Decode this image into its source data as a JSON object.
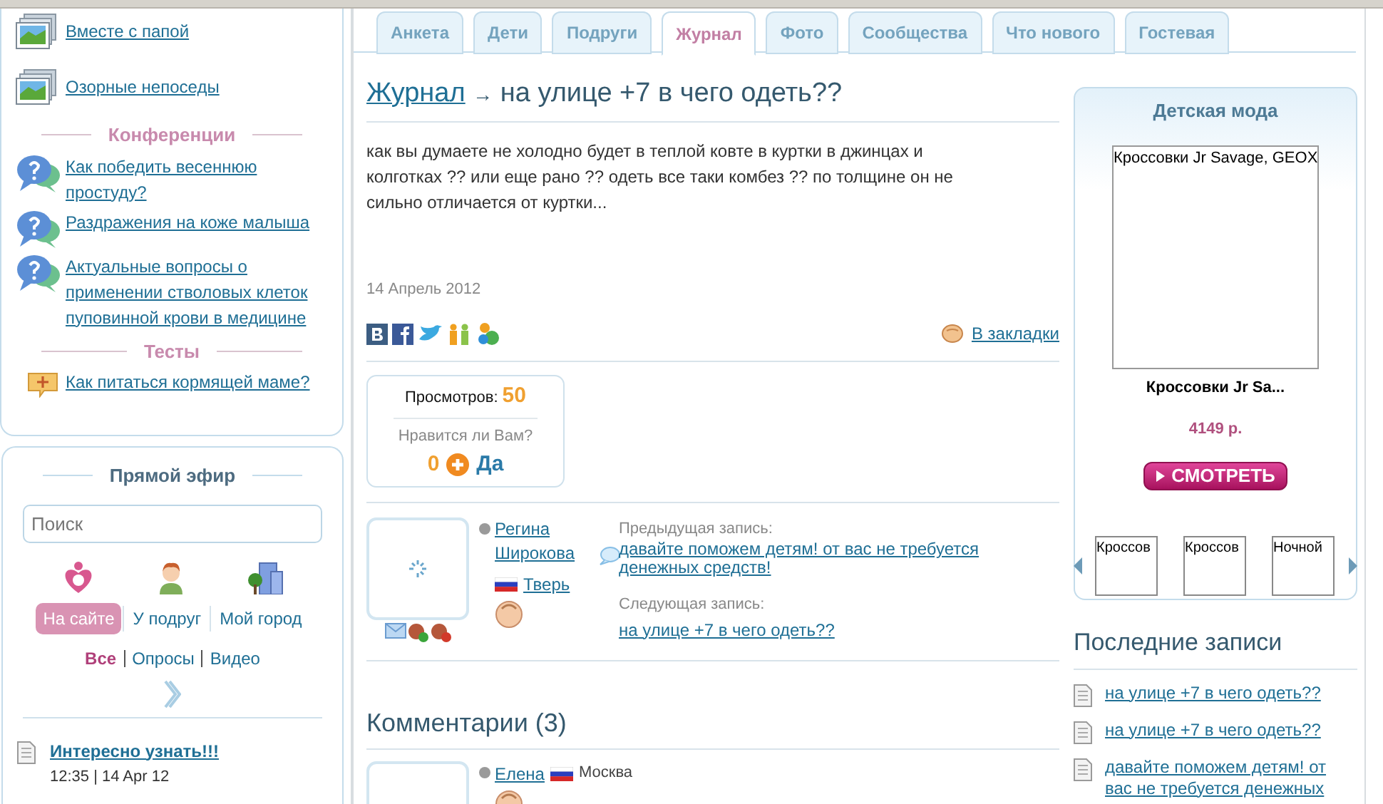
{
  "albums": [
    {
      "text": "Вместе с папой"
    },
    {
      "text": "Озорные непоседы"
    }
  ],
  "conferences": {
    "title": "Конференции",
    "items": [
      "Как победить весеннюю простуду?",
      "Раздражения на коже малыша",
      "Актуальные вопросы о применении стволовых клеток пуповинной крови в медицине"
    ]
  },
  "tests": {
    "title": "Тесты",
    "items": [
      "Как питаться кормящей маме?"
    ]
  },
  "live": {
    "title": "Прямой эфир",
    "search": {
      "placeholder": "Поиск"
    },
    "scopes": [
      {
        "label": "На сайте",
        "selected": true
      },
      {
        "label": "У подруг",
        "selected": false
      },
      {
        "label": "Мой город",
        "selected": false
      }
    ],
    "filters": [
      {
        "label": "Все",
        "selected": true
      },
      {
        "label": "Опросы",
        "selected": false
      },
      {
        "label": "Видео",
        "selected": false
      }
    ],
    "feed": [
      {
        "title": "Интересно узнать!!!",
        "meta": "12:35 | 14 Apr 12"
      }
    ]
  },
  "tabs": [
    {
      "label": "Анкета",
      "selected": false
    },
    {
      "label": "Дети",
      "selected": false
    },
    {
      "label": "Подруги",
      "selected": false
    },
    {
      "label": "Журнал",
      "selected": true
    },
    {
      "label": "Фото",
      "selected": false
    },
    {
      "label": "Сообщества",
      "selected": false
    },
    {
      "label": "Что нового",
      "selected": false
    },
    {
      "label": "Гостевая",
      "selected": false
    }
  ],
  "post": {
    "section": "Журнал",
    "arrow": "→",
    "title": "на улице +7 в чего одеть??",
    "body": "как вы думаете не холодно будет в теплой ковте в куртки в джинцах и колготках ?? или еще рано ?? одеть все таки комбез ?? по толщине он не сильно отличается от куртки...",
    "date": "14 Апрель 2012",
    "bookmark": "В закладки"
  },
  "stats": {
    "views_label": "Просмотров:",
    "views": "50",
    "question": "Нравится ли Вам?",
    "likes": "0",
    "like_button": "Да"
  },
  "author": {
    "name": "Регина Широкова",
    "online": false,
    "city": "Тверь",
    "prev_label": "Предыдущая запись:",
    "prev": "давайте поможем детям! от вас не требуется денежных средств!",
    "next_label": "Следующая запись:",
    "next": "на улице +7 в чего одеть??"
  },
  "comments": {
    "title": "Комментарии (3)",
    "items": [
      {
        "name": "Елена",
        "online": false,
        "city": "Москва"
      }
    ]
  },
  "ad": {
    "title": "Детская мода",
    "image_caption": "Кроссовки Jr Savage, GEOX",
    "product": "Кроссовки Jr Sa...",
    "price": "4149 р.",
    "button": "СМОТРЕТЬ",
    "thumbs": [
      "Кроссов",
      "Кроссов",
      "Ночной"
    ]
  },
  "recent": {
    "title": "Последние записи",
    "items": [
      "на улице +7 в чего одеть??",
      "на улице +7 в чего одеть??",
      "давайте поможем детям! от вас не требуется денежных"
    ]
  }
}
